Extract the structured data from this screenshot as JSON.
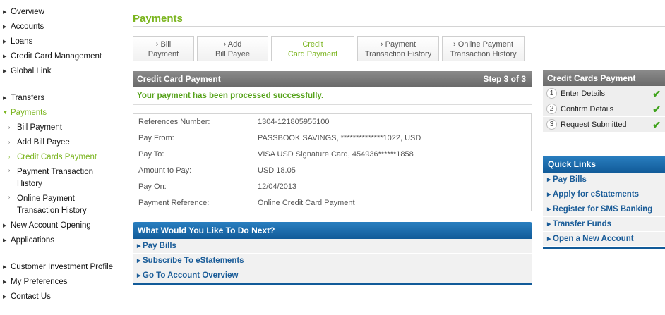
{
  "sidebar": {
    "group1": [
      "Overview",
      "Accounts",
      "Loans",
      "Credit Card Management",
      "Global Link"
    ],
    "transfers": "Transfers",
    "payments": "Payments",
    "payment_sub": [
      {
        "label": "Bill Payment"
      },
      {
        "label": "Add Bill Payee"
      },
      {
        "label": "Credit Cards Payment"
      },
      {
        "label": "Payment Transaction History"
      },
      {
        "label": "Online Payment Transaction History"
      }
    ],
    "new_account": "New Account Opening",
    "applications": "Applications",
    "group3": [
      "Customer Investment Profile",
      "My Preferences",
      "Contact Us"
    ]
  },
  "page": {
    "title": "Payments"
  },
  "tabs": [
    {
      "prefix": "› ",
      "line1": "Bill",
      "line2": "Payment"
    },
    {
      "prefix": "› ",
      "line1": "Add",
      "line2": "Bill Payee"
    },
    {
      "prefix": "",
      "line1": "Credit",
      "line2": "Card Payment"
    },
    {
      "prefix": "› ",
      "line1": "Payment",
      "line2": "Transaction History"
    },
    {
      "prefix": "› ",
      "line1": "Online Payment",
      "line2": "Transaction History"
    }
  ],
  "section": {
    "title": "Credit Card Payment",
    "step": "Step 3 of 3",
    "success": "Your payment has been processed successfully."
  },
  "details": [
    {
      "label": "References Number:",
      "value": "1304-121805955100"
    },
    {
      "label": "Pay From:",
      "value": "PASSBOOK SAVINGS, **************1022, USD"
    },
    {
      "label": "Pay To:",
      "value": "VISA USD Signature Card, 454936******1858"
    },
    {
      "label": "Amount to Pay:",
      "value": "USD 18.05"
    },
    {
      "label": "Pay On:",
      "value": "12/04/2013"
    },
    {
      "label": "Payment Reference:",
      "value": "Online Credit Card Payment"
    }
  ],
  "next": {
    "title": "What Would You Like To Do Next?",
    "links": [
      "Pay Bills",
      "Subscribe To eStatements",
      "Go To Account Overview"
    ]
  },
  "steps_panel": {
    "title": "Credit Cards Payment",
    "steps": [
      {
        "num": "1",
        "label": "Enter Details"
      },
      {
        "num": "2",
        "label": "Confirm Details"
      },
      {
        "num": "3",
        "label": "Request Submitted"
      }
    ]
  },
  "quick_links": {
    "title": "Quick Links",
    "links": [
      "Pay Bills",
      "Apply for eStatements",
      "Register for SMS Banking",
      "Transfer Funds",
      "Open a New Account"
    ]
  },
  "colors": {
    "accent_green": "#7bb51f",
    "link_blue": "#1a5c98",
    "header_blue": "#125b99",
    "header_gray": "#6a6a6a"
  }
}
